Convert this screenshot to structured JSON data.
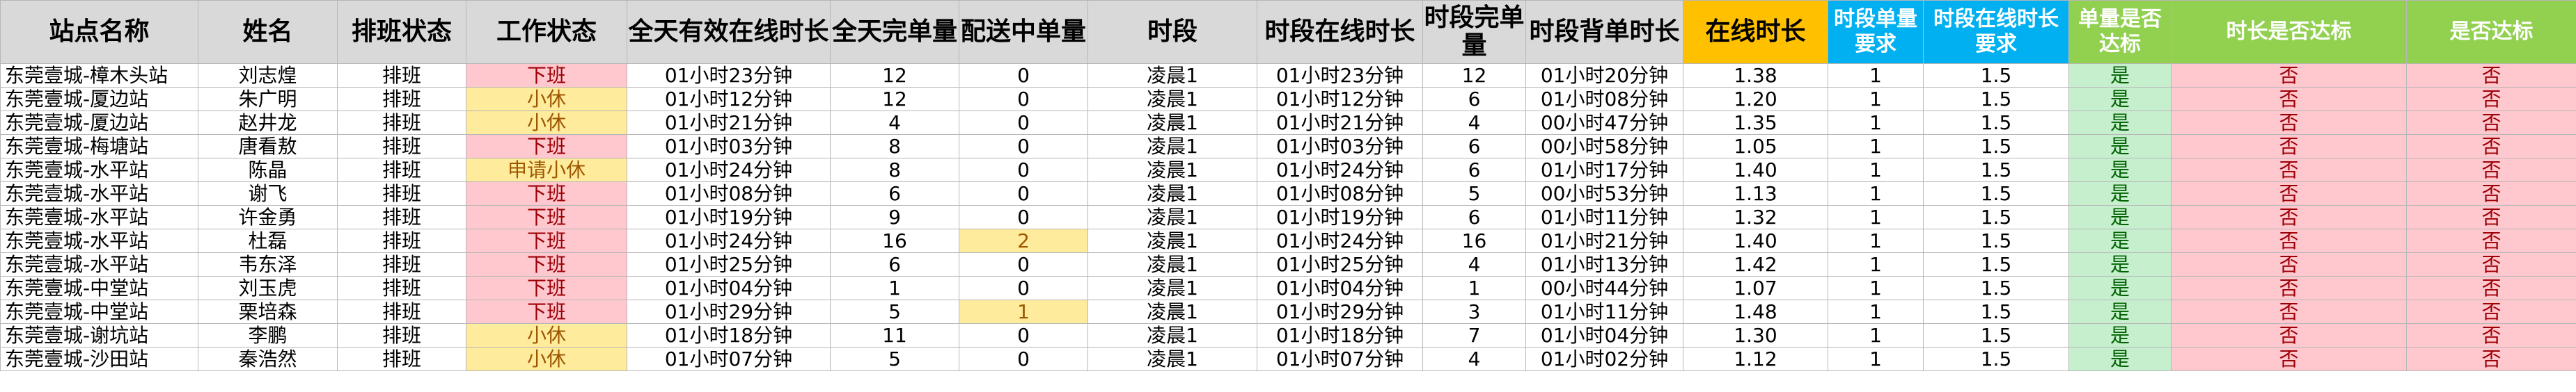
{
  "headers": [
    "站点名称",
    "姓名",
    "排班状态",
    "工作状态",
    "全天有效在线时长",
    "全天完单量",
    "配送中单量",
    "时段",
    "时段在线时长",
    "时段完单量",
    "时段背单时长",
    "在线时长",
    "时段单量要求",
    "时段在线时长要求",
    "单量是否达标",
    "时长是否达标",
    "是否达标"
  ],
  "rows": [
    {
      "station": "东莞壹城-樟木头站",
      "name": "刘志煌",
      "schedule": "排班",
      "status": "下班",
      "status_type": "xiaban",
      "day_online": "01小时23分钟",
      "day_done": "12",
      "pending": "0",
      "pending_hl": false,
      "period": "凌晨1",
      "period_online": "01小时23分钟",
      "period_done": "12",
      "period_carry": "01小时20分钟",
      "online_hours": "1.38",
      "req_orders": "1",
      "req_hours": "1.5",
      "orders_ok": "是",
      "hours_ok": "否",
      "all_ok": "否"
    },
    {
      "station": "东莞壹城-厦边站",
      "name": "朱广明",
      "schedule": "排班",
      "status": "小休",
      "status_type": "xiaoxiu",
      "day_online": "01小时12分钟",
      "day_done": "12",
      "pending": "0",
      "pending_hl": false,
      "period": "凌晨1",
      "period_online": "01小时12分钟",
      "period_done": "6",
      "period_carry": "01小时08分钟",
      "online_hours": "1.20",
      "req_orders": "1",
      "req_hours": "1.5",
      "orders_ok": "是",
      "hours_ok": "否",
      "all_ok": "否"
    },
    {
      "station": "东莞壹城-厦边站",
      "name": "赵井龙",
      "schedule": "排班",
      "status": "小休",
      "status_type": "xiaoxiu",
      "day_online": "01小时21分钟",
      "day_done": "4",
      "pending": "0",
      "pending_hl": false,
      "period": "凌晨1",
      "period_online": "01小时21分钟",
      "period_done": "4",
      "period_carry": "00小时47分钟",
      "online_hours": "1.35",
      "req_orders": "1",
      "req_hours": "1.5",
      "orders_ok": "是",
      "hours_ok": "否",
      "all_ok": "否"
    },
    {
      "station": "东莞壹城-梅塘站",
      "name": "唐看敖",
      "schedule": "排班",
      "status": "下班",
      "status_type": "xiaban",
      "day_online": "01小时03分钟",
      "day_done": "8",
      "pending": "0",
      "pending_hl": false,
      "period": "凌晨1",
      "period_online": "01小时03分钟",
      "period_done": "6",
      "period_carry": "00小时58分钟",
      "online_hours": "1.05",
      "req_orders": "1",
      "req_hours": "1.5",
      "orders_ok": "是",
      "hours_ok": "否",
      "all_ok": "否"
    },
    {
      "station": "东莞壹城-水平站",
      "name": "陈晶",
      "schedule": "排班",
      "status": "申请小休",
      "status_type": "xiaoxiu",
      "day_online": "01小时24分钟",
      "day_done": "8",
      "pending": "0",
      "pending_hl": false,
      "period": "凌晨1",
      "period_online": "01小时24分钟",
      "period_done": "6",
      "period_carry": "01小时17分钟",
      "online_hours": "1.40",
      "req_orders": "1",
      "req_hours": "1.5",
      "orders_ok": "是",
      "hours_ok": "否",
      "all_ok": "否"
    },
    {
      "station": "东莞壹城-水平站",
      "name": "谢飞",
      "schedule": "排班",
      "status": "下班",
      "status_type": "xiaban",
      "day_online": "01小时08分钟",
      "day_done": "6",
      "pending": "0",
      "pending_hl": false,
      "period": "凌晨1",
      "period_online": "01小时08分钟",
      "period_done": "5",
      "period_carry": "00小时53分钟",
      "online_hours": "1.13",
      "req_orders": "1",
      "req_hours": "1.5",
      "orders_ok": "是",
      "hours_ok": "否",
      "all_ok": "否"
    },
    {
      "station": "东莞壹城-水平站",
      "name": "许金勇",
      "schedule": "排班",
      "status": "下班",
      "status_type": "xiaban",
      "day_online": "01小时19分钟",
      "day_done": "9",
      "pending": "0",
      "pending_hl": false,
      "period": "凌晨1",
      "period_online": "01小时19分钟",
      "period_done": "6",
      "period_carry": "01小时11分钟",
      "online_hours": "1.32",
      "req_orders": "1",
      "req_hours": "1.5",
      "orders_ok": "是",
      "hours_ok": "否",
      "all_ok": "否"
    },
    {
      "station": "东莞壹城-水平站",
      "name": "杜磊",
      "schedule": "排班",
      "status": "下班",
      "status_type": "xiaban",
      "day_online": "01小时24分钟",
      "day_done": "16",
      "pending": "2",
      "pending_hl": true,
      "period": "凌晨1",
      "period_online": "01小时24分钟",
      "period_done": "16",
      "period_carry": "01小时21分钟",
      "online_hours": "1.40",
      "req_orders": "1",
      "req_hours": "1.5",
      "orders_ok": "是",
      "hours_ok": "否",
      "all_ok": "否"
    },
    {
      "station": "东莞壹城-水平站",
      "name": "韦东泽",
      "schedule": "排班",
      "status": "下班",
      "status_type": "xiaban",
      "day_online": "01小时25分钟",
      "day_done": "6",
      "pending": "0",
      "pending_hl": false,
      "period": "凌晨1",
      "period_online": "01小时25分钟",
      "period_done": "4",
      "period_carry": "01小时13分钟",
      "online_hours": "1.42",
      "req_orders": "1",
      "req_hours": "1.5",
      "orders_ok": "是",
      "hours_ok": "否",
      "all_ok": "否"
    },
    {
      "station": "东莞壹城-中堂站",
      "name": "刘玉虎",
      "schedule": "排班",
      "status": "下班",
      "status_type": "xiaban",
      "day_online": "01小时04分钟",
      "day_done": "1",
      "pending": "0",
      "pending_hl": false,
      "period": "凌晨1",
      "period_online": "01小时04分钟",
      "period_done": "1",
      "period_carry": "00小时44分钟",
      "online_hours": "1.07",
      "req_orders": "1",
      "req_hours": "1.5",
      "orders_ok": "是",
      "hours_ok": "否",
      "all_ok": "否"
    },
    {
      "station": "东莞壹城-中堂站",
      "name": "栗培森",
      "schedule": "排班",
      "status": "下班",
      "status_type": "xiaban",
      "day_online": "01小时29分钟",
      "day_done": "5",
      "pending": "1",
      "pending_hl": true,
      "period": "凌晨1",
      "period_online": "01小时29分钟",
      "period_done": "3",
      "period_carry": "01小时11分钟",
      "online_hours": "1.48",
      "req_orders": "1",
      "req_hours": "1.5",
      "orders_ok": "是",
      "hours_ok": "否",
      "all_ok": "否"
    },
    {
      "station": "东莞壹城-谢坑站",
      "name": "李鹏",
      "schedule": "排班",
      "status": "小休",
      "status_type": "xiaoxiu",
      "day_online": "01小时18分钟",
      "day_done": "11",
      "pending": "0",
      "pending_hl": false,
      "period": "凌晨1",
      "period_online": "01小时18分钟",
      "period_done": "7",
      "period_carry": "01小时04分钟",
      "online_hours": "1.30",
      "req_orders": "1",
      "req_hours": "1.5",
      "orders_ok": "是",
      "hours_ok": "否",
      "all_ok": "否"
    },
    {
      "station": "东莞壹城-沙田站",
      "name": "秦浩然",
      "schedule": "排班",
      "status": "小休",
      "status_type": "xiaoxiu",
      "day_online": "01小时07分钟",
      "day_done": "5",
      "pending": "0",
      "pending_hl": false,
      "period": "凌晨1",
      "period_online": "01小时07分钟",
      "period_done": "4",
      "period_carry": "01小时02分钟",
      "online_hours": "1.12",
      "req_orders": "1",
      "req_hours": "1.5",
      "orders_ok": "是",
      "hours_ok": "否",
      "all_ok": "否"
    }
  ]
}
